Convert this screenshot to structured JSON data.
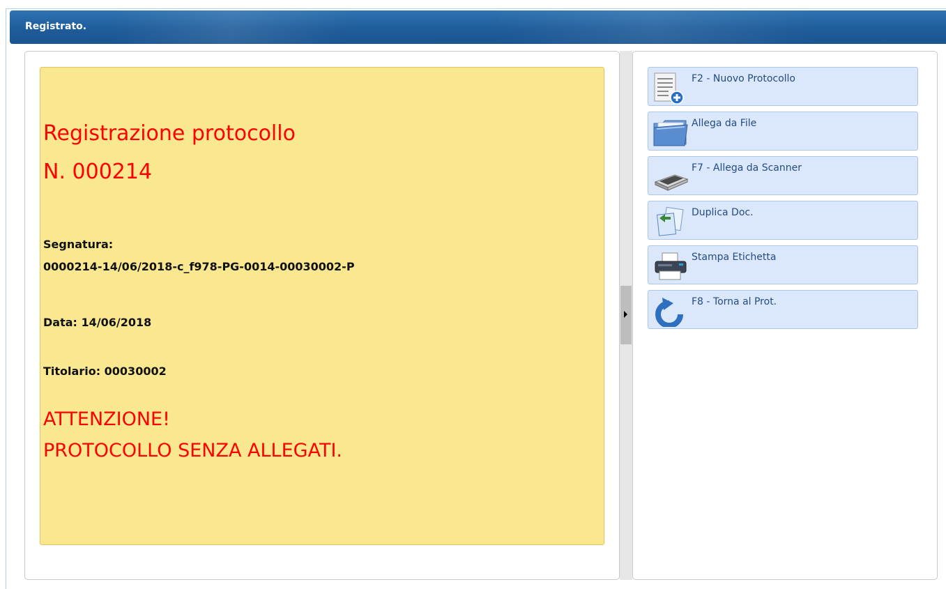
{
  "window": {
    "title": "Registrato."
  },
  "note": {
    "heading_line1": "Registrazione protocollo",
    "heading_line2": "N. 000214",
    "segnatura_label": "Segnatura:",
    "segnatura_value": "0000214-14/06/2018-c_f978-PG-0014-00030002-P",
    "data_line": "Data: 14/06/2018",
    "titolario_line": "Titolario: 00030002",
    "warning_line1": "ATTENZIONE!",
    "warning_line2": "PROTOCOLLO SENZA ALLEGATI."
  },
  "actions": [
    {
      "label": "F2 - Nuovo Protocollo",
      "icon": "new-protocol-icon"
    },
    {
      "label": "Allega da File",
      "icon": "folder-icon"
    },
    {
      "label": "F7 - Allega da Scanner",
      "icon": "scanner-icon"
    },
    {
      "label": "Duplica Doc.",
      "icon": "duplicate-icon"
    },
    {
      "label": "Stampa Etichetta",
      "icon": "printer-icon"
    },
    {
      "label": "F8 - Torna al Prot.",
      "icon": "back-arrow-icon"
    }
  ],
  "colors": {
    "titlebar": "#1f5c9a",
    "note_background": "#fae890",
    "alert_text": "#ff0000",
    "button_background": "#dbe7fb"
  }
}
